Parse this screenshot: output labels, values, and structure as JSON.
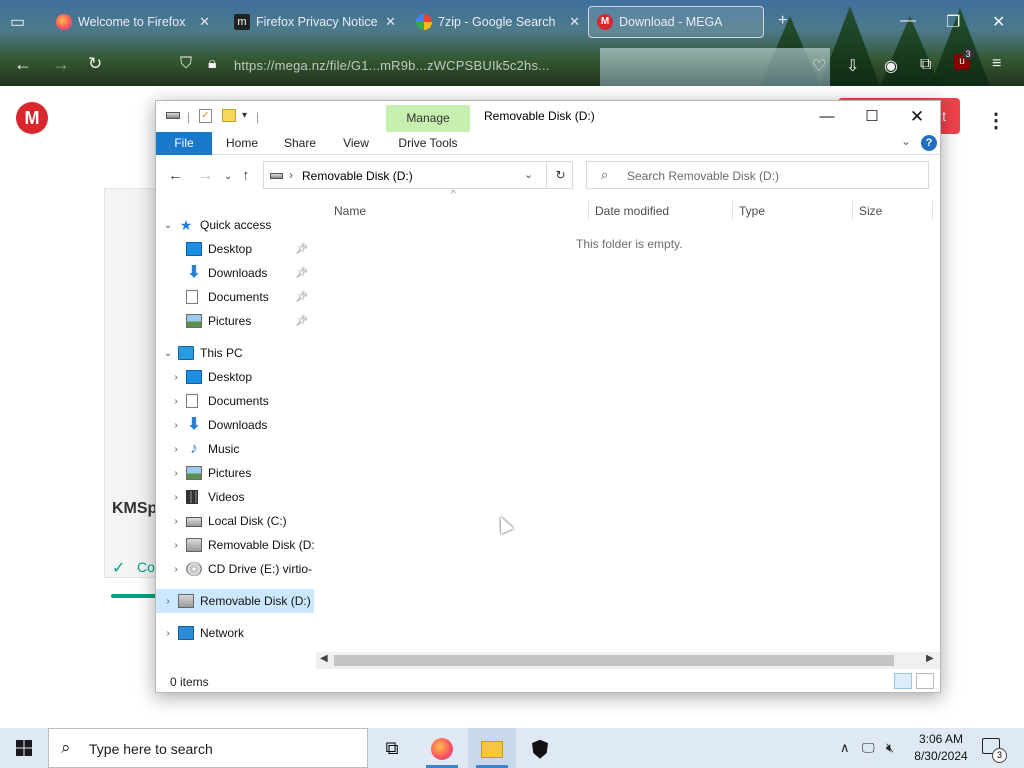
{
  "browser": {
    "tabs": [
      {
        "title": "Welcome to Firefox"
      },
      {
        "title": "Firefox Privacy Notice"
      },
      {
        "title": "7zip - Google Search"
      },
      {
        "title": "Download - MEGA"
      }
    ],
    "url_text": "https://mega.nz/file/G1...mR9b...zWCPSBUIk5c2hs...",
    "extension_badge": "3"
  },
  "mega_page": {
    "logo_letter": "M",
    "button_label": "t",
    "file_name_fragment": "KMSp",
    "status_fragment": "Co"
  },
  "explorer": {
    "quick_access_toolbar": "|",
    "contextual_tab": "Manage",
    "contextual_group": "Drive Tools",
    "window_title": "Removable Disk (D:)",
    "ribbon_tabs": {
      "file": "File",
      "home": "Home",
      "share": "Share",
      "view": "View"
    },
    "help_label": "?",
    "address_path": "Removable Disk (D:)",
    "search_placeholder": "Search Removable Disk (D:)",
    "columns": {
      "name": "Name",
      "date_modified": "Date modified",
      "type": "Type",
      "size": "Size"
    },
    "empty_message": "This folder is empty.",
    "status": "0 items",
    "nav": {
      "quick_access": "Quick access",
      "quick_items": [
        "Desktop",
        "Downloads",
        "Documents",
        "Pictures"
      ],
      "this_pc": "This PC",
      "pc_items": [
        "Desktop",
        "Documents",
        "Downloads",
        "Music",
        "Pictures",
        "Videos",
        "Local Disk (C:)",
        "Removable Disk (D:)",
        "CD Drive (E:) virtio-"
      ],
      "selected_drive": "Removable Disk (D:)",
      "network": "Network"
    }
  },
  "taskbar": {
    "search_placeholder": "Type here to search",
    "time": "3:06 AM",
    "date": "8/30/2024",
    "notification_count": "3"
  },
  "colors": {
    "file_tab": "#1979ca",
    "manage_tab": "#c6efb0",
    "selection": "#cce8ff",
    "mega_red": "#d9272e"
  }
}
